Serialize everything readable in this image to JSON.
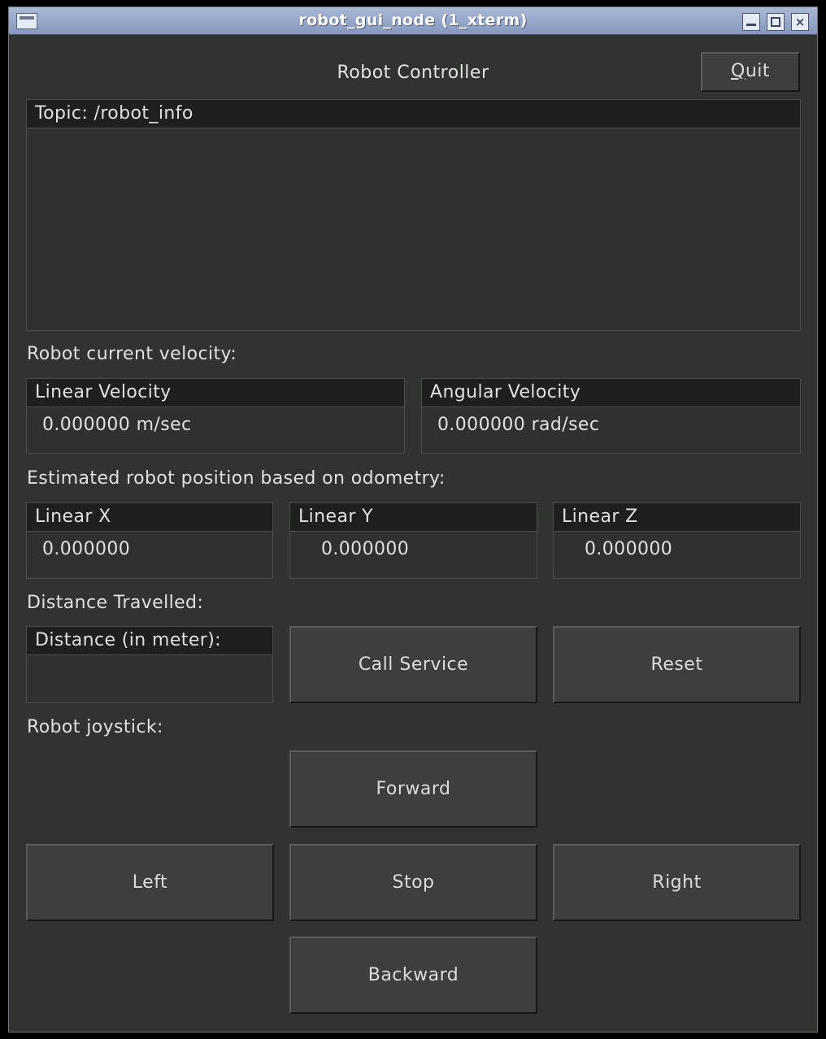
{
  "window": {
    "title": "robot_gui_node (1_xterm)",
    "controls": [
      "minimize-icon",
      "maximize-icon",
      "close-icon"
    ],
    "close_glyph": "×"
  },
  "header": {
    "title": "Robot Controller",
    "quit_label_first": "Q",
    "quit_label_rest": "uit"
  },
  "topic": {
    "header": "Topic: /robot_info",
    "content": ""
  },
  "velocity": {
    "section_label": "Robot current velocity:",
    "linear_header": "Linear Velocity",
    "linear_value": "0.000000 m/sec",
    "angular_header": "Angular Velocity",
    "angular_value": "0.000000 rad/sec"
  },
  "position": {
    "section_label": "Estimated robot position based on odometry:",
    "x_header": "Linear X",
    "x_value": "0.000000",
    "y_header": "Linear Y",
    "y_value": "0.000000",
    "z_header": "Linear Z",
    "z_value": "0.000000"
  },
  "distance": {
    "section_label": "Distance Travelled:",
    "header": "Distance (in meter):",
    "value": "",
    "call_service_label": "Call Service",
    "reset_label": "Reset"
  },
  "joystick": {
    "section_label": "Robot joystick:",
    "forward_label": "Forward",
    "left_label": "Left",
    "stop_label": "Stop",
    "right_label": "Right",
    "backward_label": "Backward"
  },
  "colors": {
    "background": "#313331",
    "titlebar": "#8797bd",
    "panel_header": "#1e1f1e",
    "button": "#3d3f3d",
    "text": "#e0e0e0"
  }
}
